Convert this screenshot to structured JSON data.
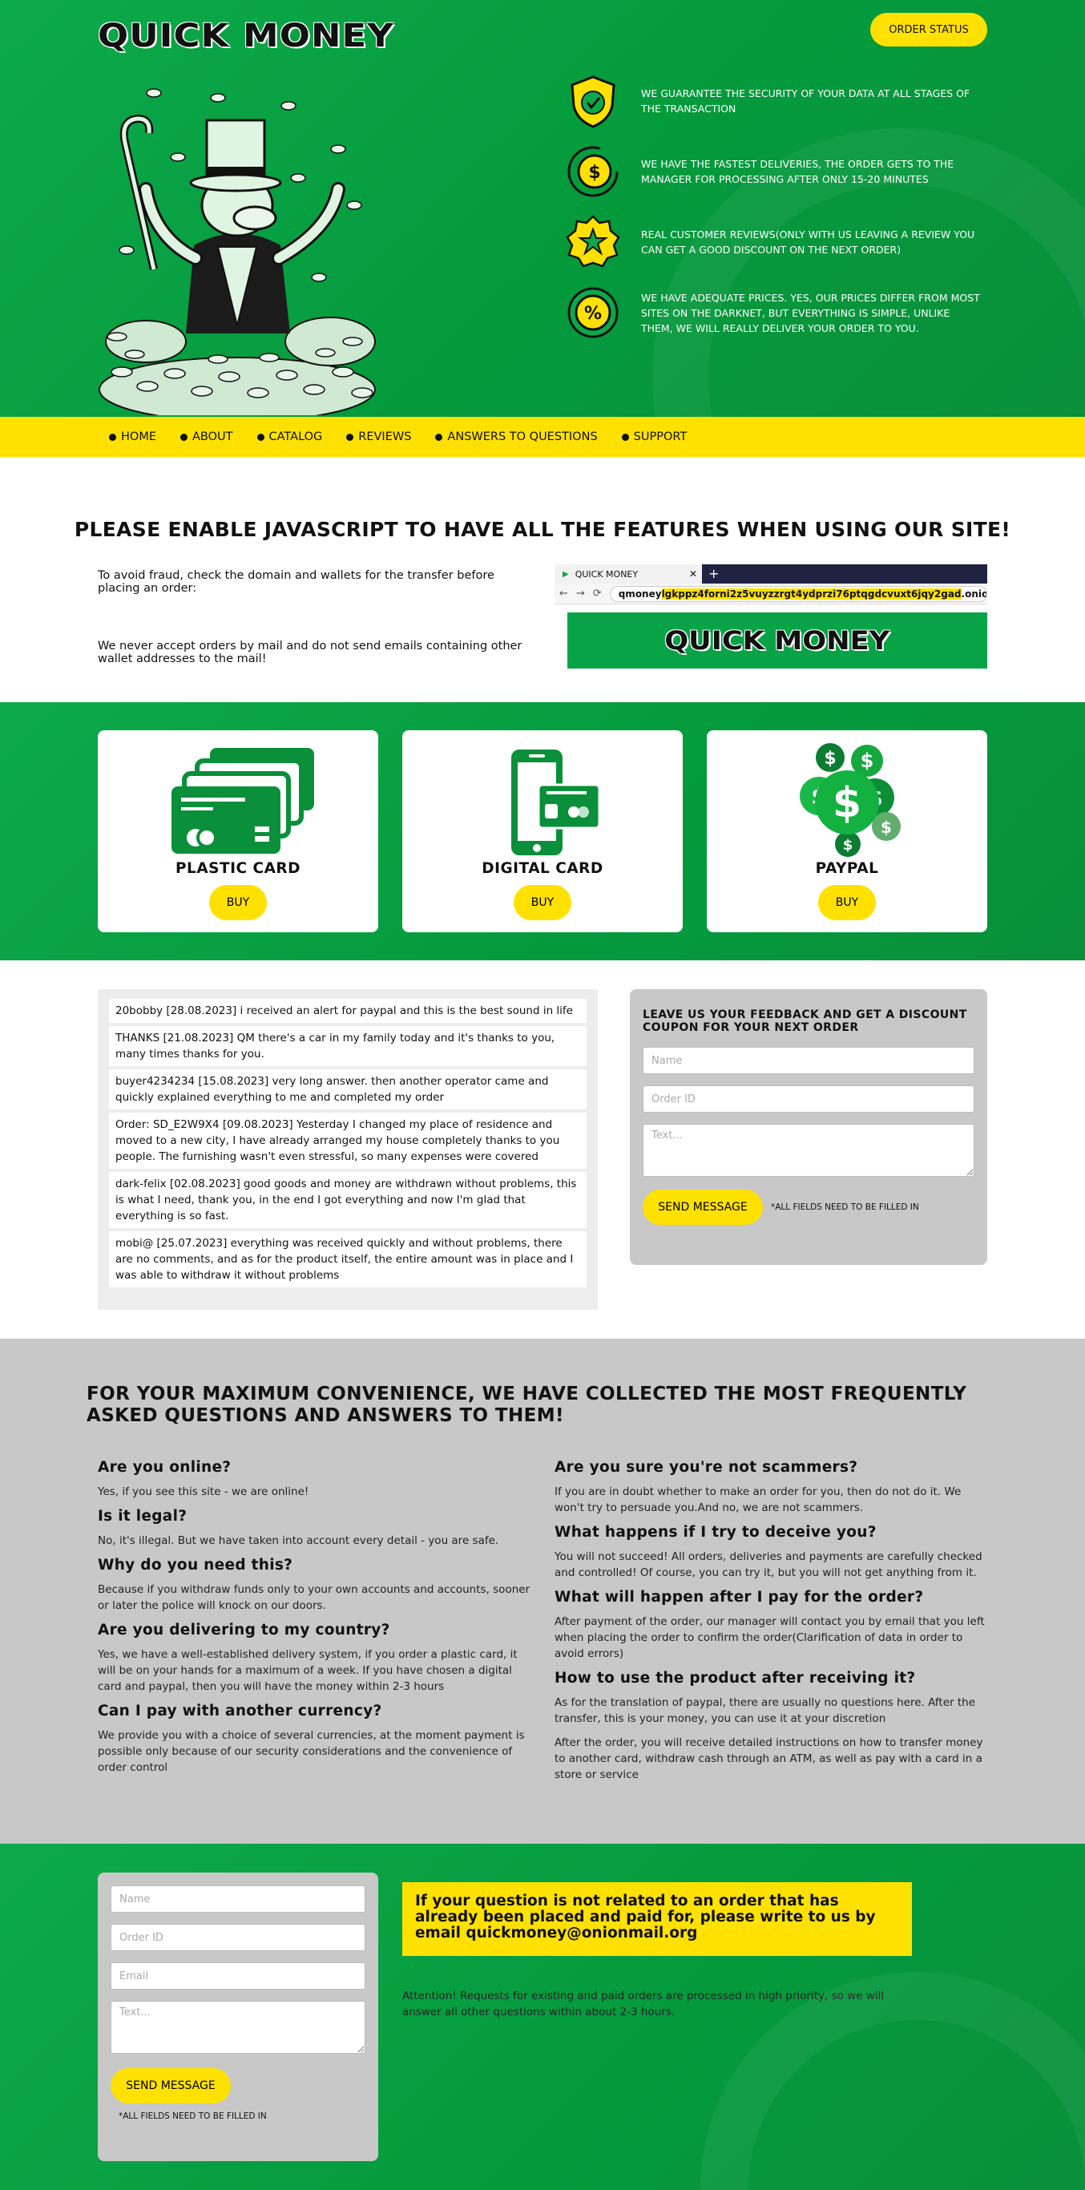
{
  "header": {
    "logo": "QUICK MONEY",
    "order_status_label": "ORDER STATUS"
  },
  "features": [
    {
      "icon": "shield-check-icon",
      "text": "WE GUARANTEE THE SECURITY OF YOUR DATA AT ALL STAGES OF THE TRANSACTION"
    },
    {
      "icon": "fast-dollar-icon",
      "text": "WE HAVE THE FASTEST DELIVERIES, THE ORDER GETS TO THE MANAGER FOR PROCESSING AFTER ONLY 15-20 MINUTES"
    },
    {
      "icon": "star-badge-icon",
      "text": "REAL CUSTOMER REVIEWS(ONLY WITH US LEAVING A REVIEW YOU CAN GET A GOOD DISCOUNT ON THE NEXT ORDER)"
    },
    {
      "icon": "percent-icon",
      "text": "WE HAVE ADEQUATE PRICES. YES, OUR PRICES DIFFER FROM MOST SITES ON THE DARKNET, BUT EVERYTHING IS SIMPLE, UNLIKE THEM, WE WILL REALLY DELIVER YOUR ORDER TO YOU."
    }
  ],
  "nav": [
    {
      "label": "HOME"
    },
    {
      "label": "ABOUT"
    },
    {
      "label": "CATALOG"
    },
    {
      "label": "REVIEWS"
    },
    {
      "label": "ANSWERS TO QUESTIONS"
    },
    {
      "label": "SUPPORT"
    }
  ],
  "notice": {
    "heading": "PLEASE ENABLE JAVASCRIPT TO HAVE ALL THE FEATURES WHEN USING OUR SITE!",
    "fraud_text": "To avoid fraud, check the domain and wallets for the transfer before placing an order:",
    "mail_text": "We never accept orders by mail and do not send emails containing other wallet addresses to the mail!",
    "browser": {
      "tab_title": "QUICK MONEY",
      "url_prefix": "qmoney",
      "url_highlight": "lgkppz4forni2z5vuyzzrgt4ydprzi76ptqgdcvuxt6jqy2gad",
      "url_suffix": ".onion",
      "preview_logo": "QUICK MONEY"
    }
  },
  "products": [
    {
      "title": "PLASTIC CARD",
      "button": "BUY",
      "icon": "cards-stack-icon"
    },
    {
      "title": "DIGITAL CARD",
      "button": "BUY",
      "icon": "phone-card-icon"
    },
    {
      "title": "PAYPAL",
      "button": "BUY",
      "icon": "dollar-coins-icon"
    }
  ],
  "reviews": [
    "20bobby [28.08.2023] i received an alert for paypal and this is the best sound in life",
    "THANKS [21.08.2023] QM there's a car in my family today and it's thanks to you, many times thanks for you.",
    "buyer4234234 [15.08.2023] very long answer. then another operator came and quickly explained everything to me and completed my order",
    "Order: SD_E2W9X4 [09.08.2023] Yesterday I changed my place of residence and moved to a new city, I have already arranged my house completely thanks to you people. The furnishing wasn't even stressful, so many expenses were covered",
    "dark-felix [02.08.2023] good goods and money are withdrawn without problems, this is what I need, thank you, in the end I got everything and now I'm glad that everything is so fast.",
    "mobi@ [25.07.2023] everything was received quickly and without problems, there are no comments, and as for the product itself, the entire amount was in place and I was able to withdraw it without problems"
  ],
  "feedback": {
    "heading": "LEAVE US YOUR FEEDBACK AND GET A DISCOUNT COUPON FOR YOUR NEXT ORDER",
    "name_placeholder": "Name",
    "order_placeholder": "Order ID",
    "text_placeholder": "Text...",
    "send_label": "SEND MESSAGE",
    "note": "*ALL FIELDS NEED TO BE FILLED IN"
  },
  "faq": {
    "heading": "FOR YOUR MAXIMUM CONVENIENCE, WE HAVE COLLECTED THE MOST FREQUENTLY ASKED QUESTIONS AND ANSWERS TO THEM!",
    "left": [
      {
        "q": "Are you online?",
        "a": [
          "Yes, if you see this site - we are online!"
        ]
      },
      {
        "q": "Is it legal?",
        "a": [
          "No, it's illegal. But we have taken into account every detail - you are safe."
        ]
      },
      {
        "q": "Why do you need this?",
        "a": [
          "Because if you withdraw funds only to your own accounts and accounts, sooner or later the police will knock on our doors."
        ]
      },
      {
        "q": "Are you delivering to my country?",
        "a": [
          "Yes, we have a well-established delivery system, if you order a plastic card, it will be on your hands for a maximum of a week. If you have chosen a digital card and paypal, then you will have the money within 2-3 hours"
        ]
      },
      {
        "q": "Can I pay with another currency?",
        "a": [
          "We provide you with a choice of several currencies, at the moment payment is possible only because of our security considerations and the convenience of order control"
        ]
      }
    ],
    "right": [
      {
        "q": "Are you sure you're not scammers?",
        "a": [
          "If you are in doubt whether to make an order for you, then do not do it. We won't try to persuade you.And no, we are not scammers."
        ]
      },
      {
        "q": "What happens if I try to deceive you?",
        "a": [
          "You will not succeed! All orders, deliveries and payments are carefully checked and controlled! Of course, you can try it, but you will not get anything from it."
        ]
      },
      {
        "q": "What will happen after I pay for the order?",
        "a": [
          "After payment of the order, our manager will contact you by email that you left when placing the order to confirm the order(Clarification of data in order to avoid errors)"
        ]
      },
      {
        "q": "How to use the product after receiving it?",
        "a": [
          "As for the translation of paypal, there are usually no questions here. After the transfer, this is your money, you can use it at your discretion",
          "After the order, you will receive detailed instructions on how to transfer money to another card, withdraw cash through an ATM, as well as pay with a card in a store or service"
        ]
      }
    ]
  },
  "contact": {
    "name_placeholder": "Name",
    "order_placeholder": "Order ID",
    "email_placeholder": "Email",
    "text_placeholder": "Text...",
    "send_label": "SEND MESSAGE",
    "note": "*ALL FIELDS NEED TO BE FILLED IN",
    "highlight": "If your question is not related to an order that has already been placed and paid for, please write to us by email quickmoney@onionmail.org",
    "attention": "Attention! Requests for existing and paid orders are processed in high priority, so we will answer all other questions within about 2-3 hours."
  },
  "colors": {
    "brand_green": "#0ca94a",
    "accent_yellow": "#ffe100",
    "panel_gray": "#c8c8c8"
  }
}
